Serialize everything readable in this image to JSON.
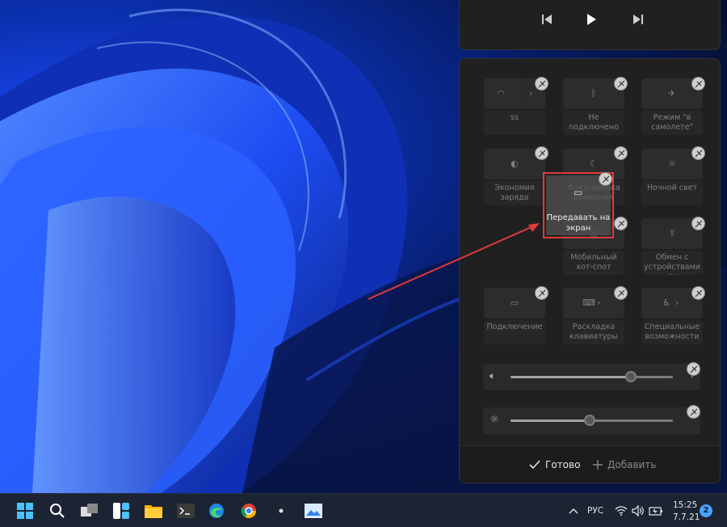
{
  "tiles": [
    {
      "label": "ss",
      "icon": "wifi-icon",
      "chevron": true
    },
    {
      "label": "Не подключено",
      "icon": "bluetooth-icon",
      "chevron": false
    },
    {
      "label": "Режим \"в самолете\"",
      "icon": "airplane-icon",
      "chevron": false
    },
    {
      "label": "Экономия заряда",
      "icon": "battery-saver-icon",
      "chevron": false
    },
    {
      "label": "Фокусировка внимания",
      "icon": "moon-icon",
      "chevron": false
    },
    {
      "label": "Ночной свет",
      "icon": "night-light-icon",
      "chevron": false
    },
    {
      "label": "Мобильный хот-спот",
      "icon": "hotspot-icon",
      "chevron": false
    },
    {
      "label": "Обмен с устройствами по",
      "icon": "share-icon",
      "chevron": false
    },
    {
      "label": "Подключение",
      "icon": "cast-connect-icon",
      "chevron": false
    },
    {
      "label": "Раскладка клавиатуры",
      "icon": "keyboard-icon",
      "chevron": true
    },
    {
      "label": "Специальные возможности",
      "icon": "accessibility-icon",
      "chevron": true
    }
  ],
  "dragged_tile": {
    "label": "Передавать на экран",
    "icon": "project-screen-icon"
  },
  "sliders": {
    "volume": {
      "level": 0.74,
      "icon": "speaker-icon"
    },
    "brightness": {
      "level": 0.49,
      "icon": "sun-icon"
    }
  },
  "footer": {
    "done_label": "Готово",
    "add_label": "Добавить"
  },
  "tray": {
    "language": "РУС",
    "time": "15:25",
    "date": "7.7.21",
    "notifications": "2"
  }
}
